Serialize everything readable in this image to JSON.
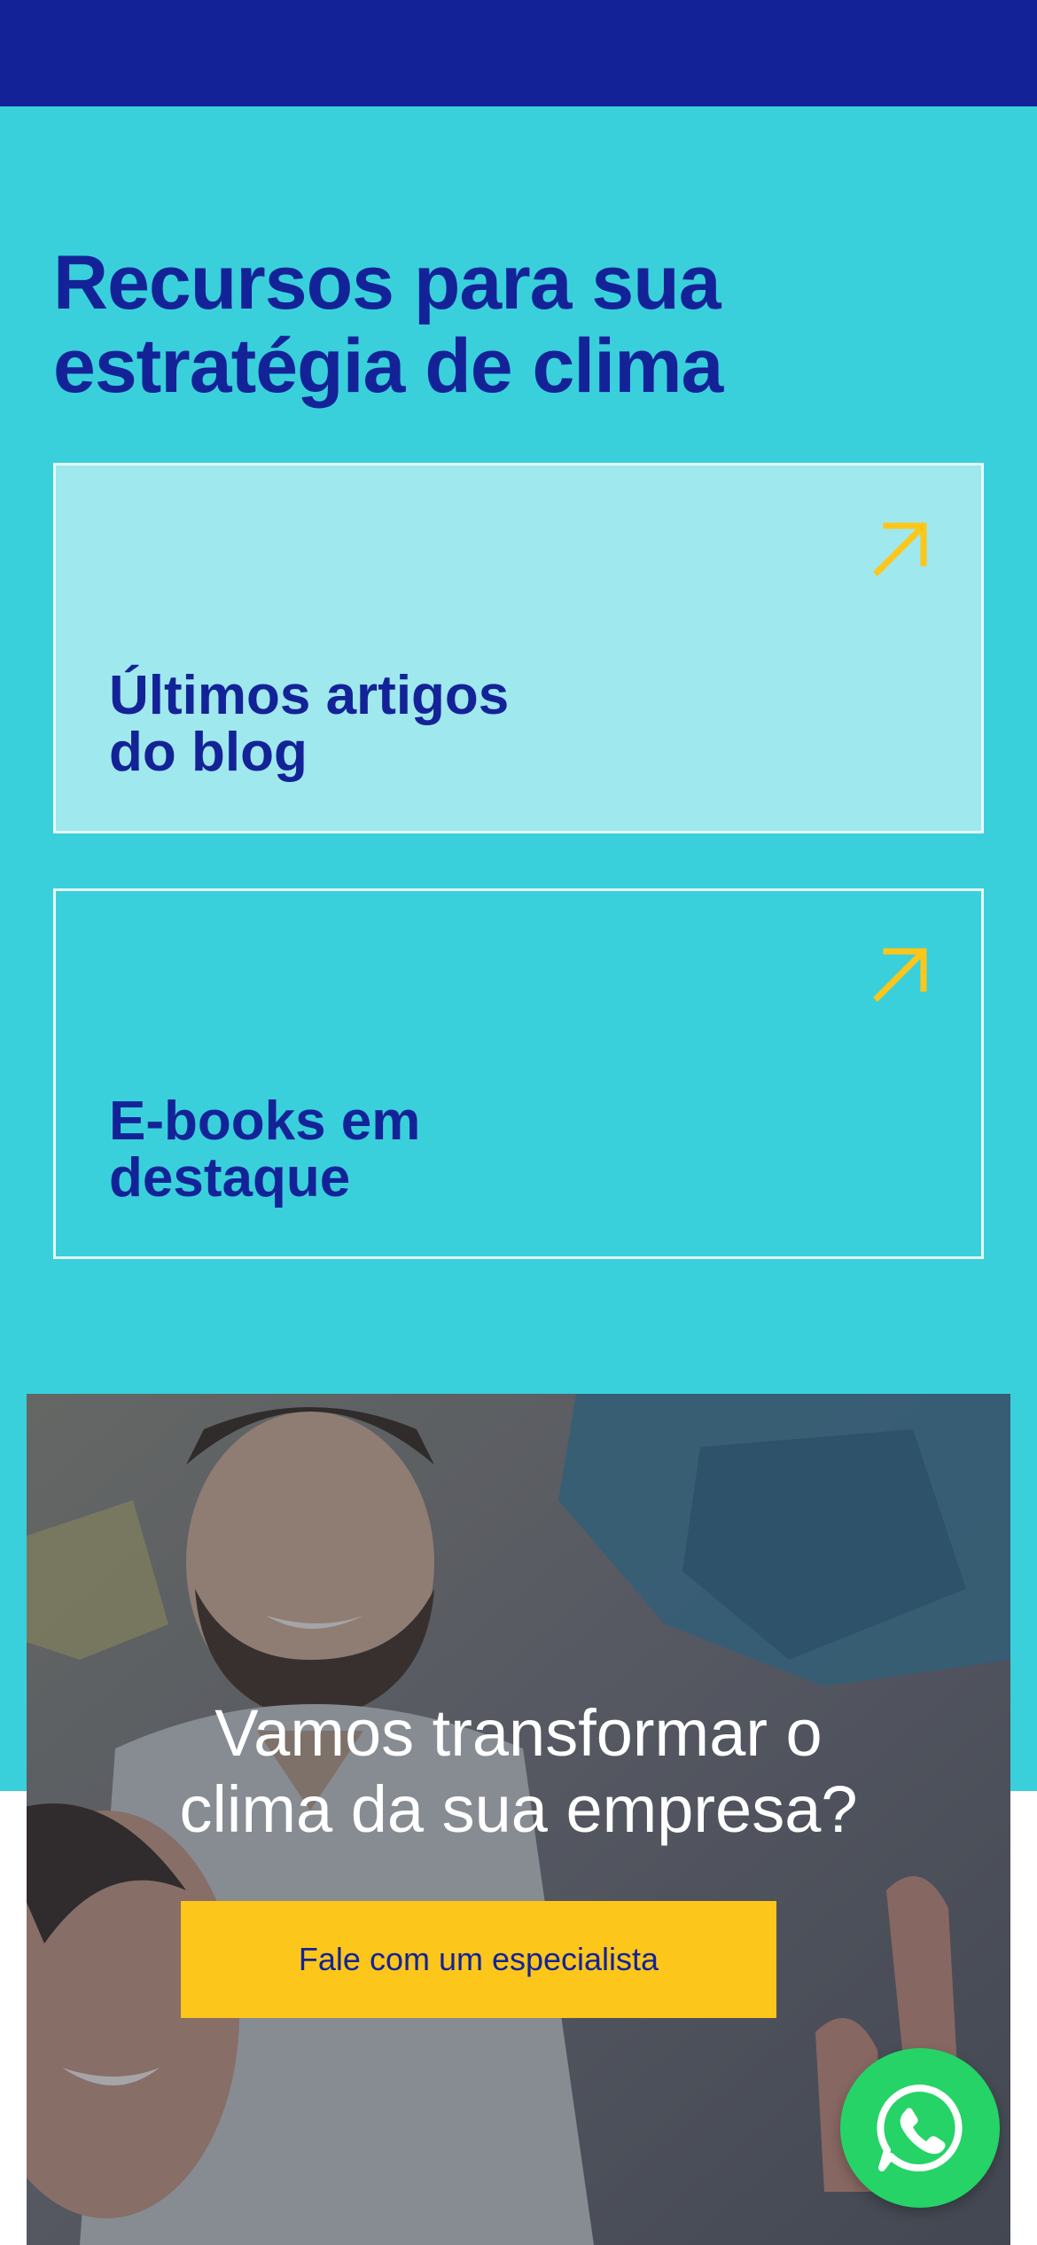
{
  "header": {
    "bar_color": "#132397"
  },
  "resources": {
    "title_line1": "Recursos para sua",
    "title_line2": "estratégia de clima",
    "background_color": "#39d0dc",
    "cards": [
      {
        "title_line1": "Últimos artigos",
        "title_line2": "do blog",
        "icon": "arrow-up-right-icon",
        "background": "#9fe8ed"
      },
      {
        "title_line1": "E-books em",
        "title_line2": "destaque",
        "icon": "arrow-up-right-icon",
        "background": "#39d0dc"
      }
    ],
    "arrow_color": "#fdc61a"
  },
  "cta": {
    "heading_line1": "Vamos transformar o",
    "heading_line2": "clima da sua empresa?",
    "button_label": "Fale com um especialista",
    "button_color": "#fdc61a"
  },
  "whatsapp": {
    "icon": "whatsapp-icon",
    "color": "#25d366"
  }
}
